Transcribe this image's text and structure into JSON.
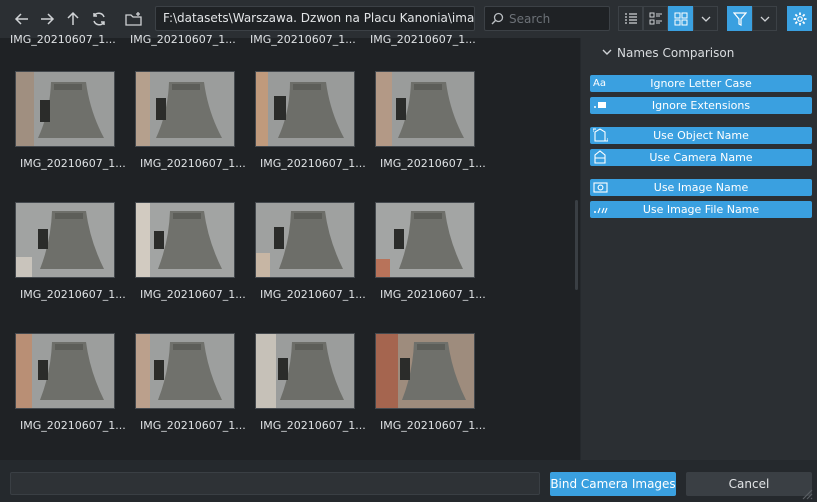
{
  "toolbar": {
    "path": "F:\\datasets\\Warszawa. Dzwon na Placu Kanonia\\images\\",
    "search_placeholder": "Search",
    "buttons": [
      "back-icon",
      "forward-icon",
      "up-icon",
      "refresh-icon",
      "new-folder-icon",
      "list-view-icon",
      "details-view-icon",
      "thumbnail-view-icon",
      "view-dropdown-icon",
      "filter-icon",
      "filter-dropdown-icon",
      "settings-icon"
    ]
  },
  "gallery": {
    "top_captions": [
      "IMG_20210607_1...",
      "IMG_20210607_1...",
      "IMG_20210607_1...",
      "IMG_20210607_1..."
    ],
    "items": [
      {
        "label": "IMG_20210607_1..."
      },
      {
        "label": "IMG_20210607_1..."
      },
      {
        "label": "IMG_20210607_1..."
      },
      {
        "label": "IMG_20210607_1..."
      },
      {
        "label": "IMG_20210607_1..."
      },
      {
        "label": "IMG_20210607_1..."
      },
      {
        "label": "IMG_20210607_1..."
      },
      {
        "label": "IMG_20210607_1..."
      },
      {
        "label": "IMG_20210607_1..."
      },
      {
        "label": "IMG_20210607_1..."
      },
      {
        "label": "IMG_20210607_1..."
      },
      {
        "label": "IMG_20210607_1..."
      }
    ]
  },
  "panel": {
    "title": "Names Comparison",
    "options": [
      {
        "icon": "Aa",
        "label": "Ignore Letter Case"
      },
      {
        "icon": "ext-icon",
        "label": "Ignore Extensions"
      },
      {
        "icon": "object-icon",
        "label": "Use Object Name"
      },
      {
        "icon": "camera-icon",
        "label": "Use Camera Name"
      },
      {
        "icon": "image-icon",
        "label": "Use Image Name"
      },
      {
        "icon": "image-file-icon",
        "label": "Use Image File Name"
      }
    ]
  },
  "footer": {
    "bind_label": "Bind Camera Images",
    "cancel_label": "Cancel",
    "input_value": ""
  },
  "colors": {
    "accent": "#3aa0e0",
    "background": "#25292d",
    "panel": "#2b2f33"
  }
}
